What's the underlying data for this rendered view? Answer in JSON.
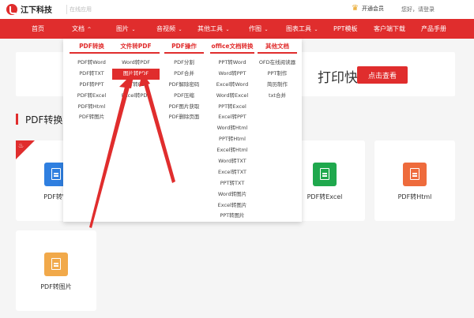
{
  "top": {
    "brand": "江下科技",
    "search_placeholder": "在线应用",
    "vip_label": "开通会员",
    "user_text": "您好，请登录"
  },
  "nav": {
    "items": [
      {
        "label": "首页",
        "caret": ""
      },
      {
        "label": "文档",
        "caret": "^"
      },
      {
        "label": "图片",
        "caret": "⌄"
      },
      {
        "label": "音视频",
        "caret": "⌄"
      },
      {
        "label": "其他工具",
        "caret": "⌄"
      },
      {
        "label": "作图",
        "caret": "⌄"
      },
      {
        "label": "图表工具",
        "caret": "⌄"
      },
      {
        "label": "PPT模板",
        "caret": ""
      },
      {
        "label": "客户端下载",
        "caret": ""
      },
      {
        "label": "产品手册",
        "caret": ""
      }
    ]
  },
  "banner": {
    "title": "打印快",
    "button": "点击查看"
  },
  "section": {
    "title": "PDF转换"
  },
  "cards": [
    {
      "label": "PDF转W",
      "color": "#2f7fe0"
    },
    {
      "label": "PDF转Excel",
      "color": "#1fa84d"
    },
    {
      "label": "PDF转Html",
      "color": "#ee6b3c"
    },
    {
      "label": "PDF转图片",
      "color": "#f1a94a"
    }
  ],
  "dropdown": {
    "columns": [
      {
        "head": "PDF转换",
        "items": [
          "PDF转Word",
          "PDF转TXT",
          "PDF转PPT",
          "PDF转Excel",
          "PDF转Html",
          "PDF转图片"
        ]
      },
      {
        "head": "文件转PDF",
        "items": [
          "Word转PDF",
          "图片转PDF",
          "PPT转PDF",
          "Excel转PDF"
        ],
        "active": 1
      },
      {
        "head": "PDF操作",
        "items": [
          "PDF分割",
          "PDF合并",
          "PDF解除密码",
          "PDF压缩",
          "PDF图片获取",
          "PDF删除页面"
        ]
      },
      {
        "head": "office文档转换",
        "items": [
          "PPT转Word",
          "Word转PPT",
          "Excel转Word",
          "Word转Excel",
          "PPT转Excel",
          "Excel转PPT",
          "Word转Html",
          "PPT转Html",
          "Excel转Html",
          "Word转TXT",
          "Excel转TXT",
          "PPT转TXT",
          "Word转图片",
          "Excel转图片",
          "PPT转图片"
        ]
      },
      {
        "head": "其他文档",
        "items": [
          "OFD在线阅读器",
          "PPT制作",
          "简历制作",
          "txt合并"
        ]
      }
    ]
  },
  "colors": {
    "brand_red": "#e02d2d"
  }
}
